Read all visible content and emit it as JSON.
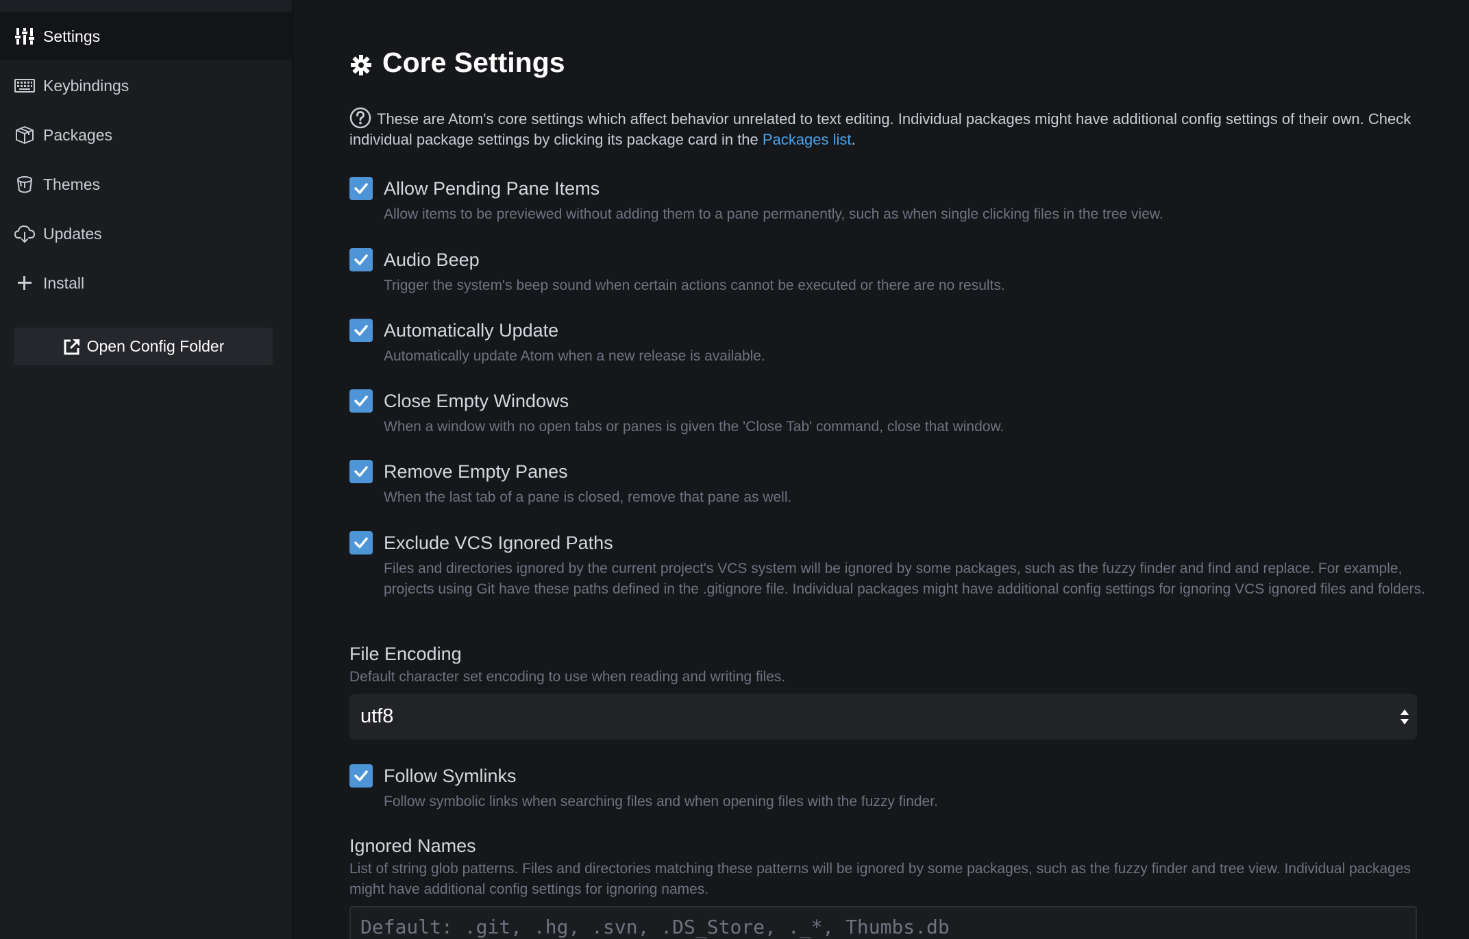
{
  "sidebar": {
    "items": [
      {
        "label": "Settings",
        "icon": "sliders-icon",
        "active": true
      },
      {
        "label": "Keybindings",
        "icon": "keyboard-icon",
        "active": false
      },
      {
        "label": "Packages",
        "icon": "package-icon",
        "active": false
      },
      {
        "label": "Themes",
        "icon": "paintcan-icon",
        "active": false
      },
      {
        "label": "Updates",
        "icon": "cloud-download-icon",
        "active": false
      },
      {
        "label": "Install",
        "icon": "plus-icon",
        "active": false
      }
    ],
    "open_config_label": "Open Config Folder"
  },
  "main": {
    "title": "Core Settings",
    "intro_text": "These are Atom's core settings which affect behavior unrelated to text editing. Individual packages might have additional config settings of their own. Check individual package settings by clicking its package card in the ",
    "intro_link": "Packages list",
    "intro_end": ".",
    "settings": [
      {
        "title": "Allow Pending Pane Items",
        "checked": true,
        "desc": "Allow items to be previewed without adding them to a pane permanently, such as when single clicking files in the tree view."
      },
      {
        "title": "Audio Beep",
        "checked": true,
        "desc": "Trigger the system's beep sound when certain actions cannot be executed or there are no results."
      },
      {
        "title": "Automatically Update",
        "checked": true,
        "desc": "Automatically update Atom when a new release is available."
      },
      {
        "title": "Close Empty Windows",
        "checked": true,
        "desc": "When a window with no open tabs or panes is given the 'Close Tab' command, close that window."
      },
      {
        "title": "Remove Empty Panes",
        "checked": true,
        "desc": "When the last tab of a pane is closed, remove that pane as well."
      },
      {
        "title": "Exclude VCS Ignored Paths",
        "checked": true,
        "desc": "Files and directories ignored by the current project's VCS system will be ignored by some packages, such as the fuzzy finder and find and replace. For example, projects using Git have these paths defined in the .gitignore file. Individual packages might have additional config settings for ignoring VCS ignored files and folders."
      }
    ],
    "file_encoding": {
      "title": "File Encoding",
      "desc": "Default character set encoding to use when reading and writing files.",
      "value": "utf8"
    },
    "follow_symlinks": {
      "title": "Follow Symlinks",
      "checked": true,
      "desc": "Follow symbolic links when searching files and when opening files with the fuzzy finder."
    },
    "ignored_names": {
      "title": "Ignored Names",
      "desc": "List of string glob patterns. Files and directories matching these patterns will be ignored by some packages, such as the fuzzy finder and tree view. Individual packages might have additional config settings for ignoring names.",
      "placeholder": "Default: .git, .hg, .svn, .DS_Store, ._*, Thumbs.db"
    }
  },
  "colors": {
    "accent": "#4d95d6",
    "link": "#4aa3e8",
    "background": "#16171b",
    "sidebar": "#1b1c20"
  }
}
